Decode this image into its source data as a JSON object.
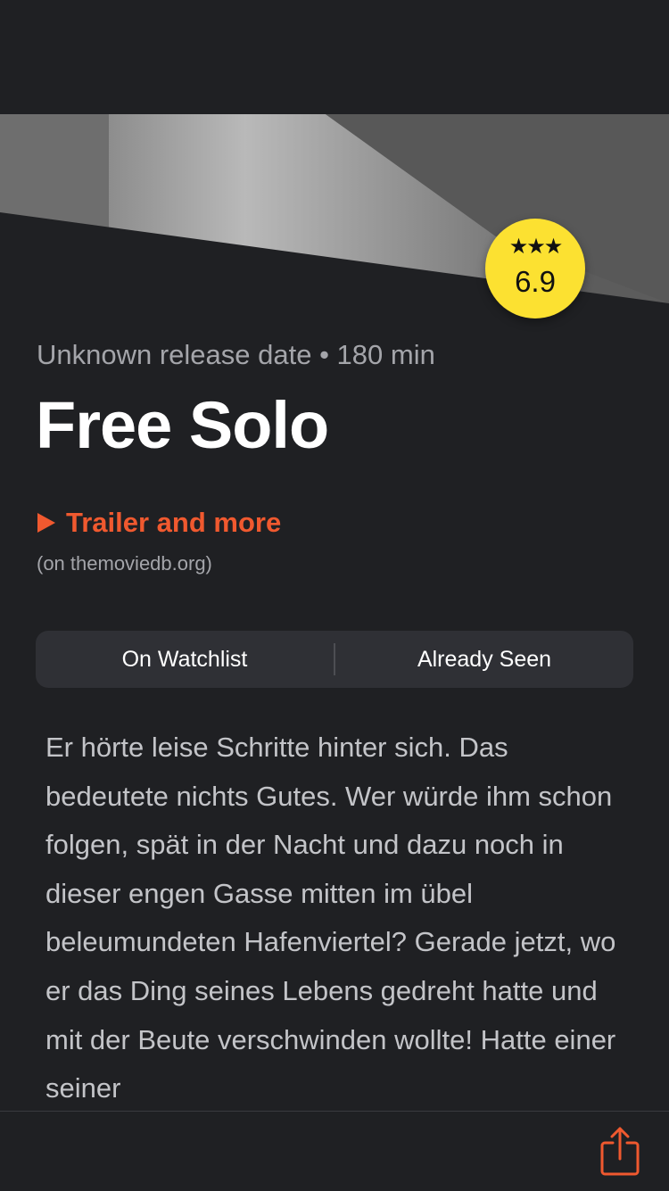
{
  "movie": {
    "rating": "6.9",
    "rating_stars": "★★★",
    "meta": "Unknown release date • 180 min",
    "title": "Free Solo",
    "trailer_label": "Trailer and more",
    "source_note": "(on themoviedb.org)",
    "overview": "Er hörte leise Schritte hinter sich. Das bedeutete nichts Gutes. Wer würde ihm schon folgen, spät in der Nacht und dazu noch in dieser engen Gasse mitten im übel beleumundeten Hafenviertel? Gerade jetzt, wo er das Ding seines Lebens gedreht hatte und mit der Beute verschwinden wollte! Hatte einer seiner"
  },
  "actions": {
    "watchlist_label": "On Watchlist",
    "seen_label": "Already Seen"
  },
  "colors": {
    "background": "#1f2023",
    "accent": "#f0592f",
    "rating_badge": "#fce131",
    "segment_bg": "#2f3035"
  },
  "icons": {
    "play": "play-icon",
    "share": "share-icon",
    "star": "star-icon"
  }
}
